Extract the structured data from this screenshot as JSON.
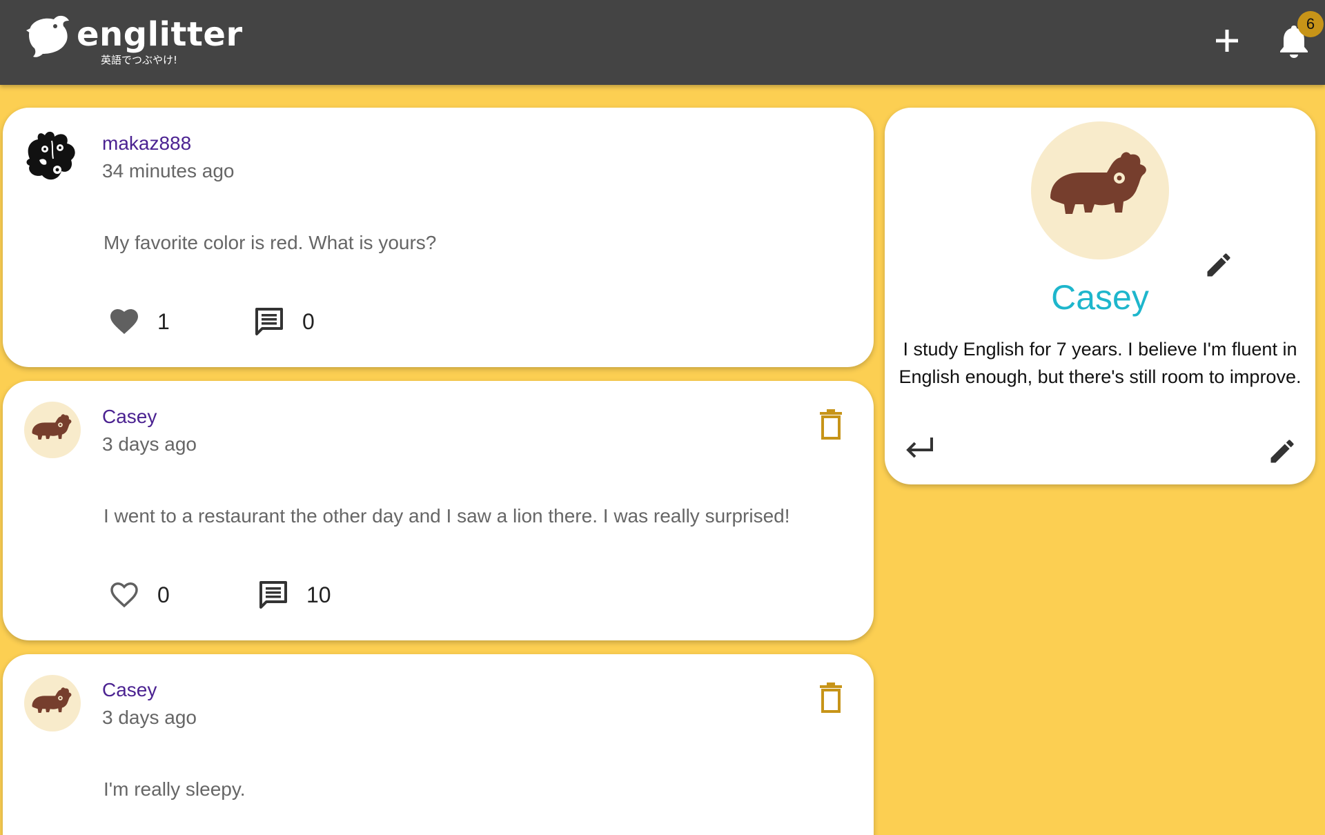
{
  "header": {
    "logo_title": "englitter",
    "logo_subtitle": "英語でつぶやけ!",
    "add_icon": "plus-icon",
    "notification_icon": "bell-icon",
    "notification_count": "6",
    "background_color": "#444444"
  },
  "page": {
    "background_color": "#fccf52"
  },
  "posts": [
    {
      "username": "makaz888",
      "time": "34 minutes ago",
      "text": "My favorite color is red. What is yours?",
      "likes": "1",
      "liked": true,
      "comments": "0",
      "deletable": false
    },
    {
      "username": "Casey",
      "time": "3 days ago",
      "text": "I went to a restaurant the other day and I saw a lion there. I was really surprised!",
      "likes": "0",
      "liked": false,
      "comments": "10",
      "deletable": true
    },
    {
      "username": "Casey",
      "time": "3 days ago",
      "text": "I'm really sleepy.",
      "deletable": true
    }
  ],
  "profile": {
    "name": "Casey",
    "bio": "I study English for 7 years. I believe I'm fluent in English enough, but there's still room to improve.",
    "name_color": "#1eb6cc",
    "avatar_icon": "hippo-icon"
  }
}
